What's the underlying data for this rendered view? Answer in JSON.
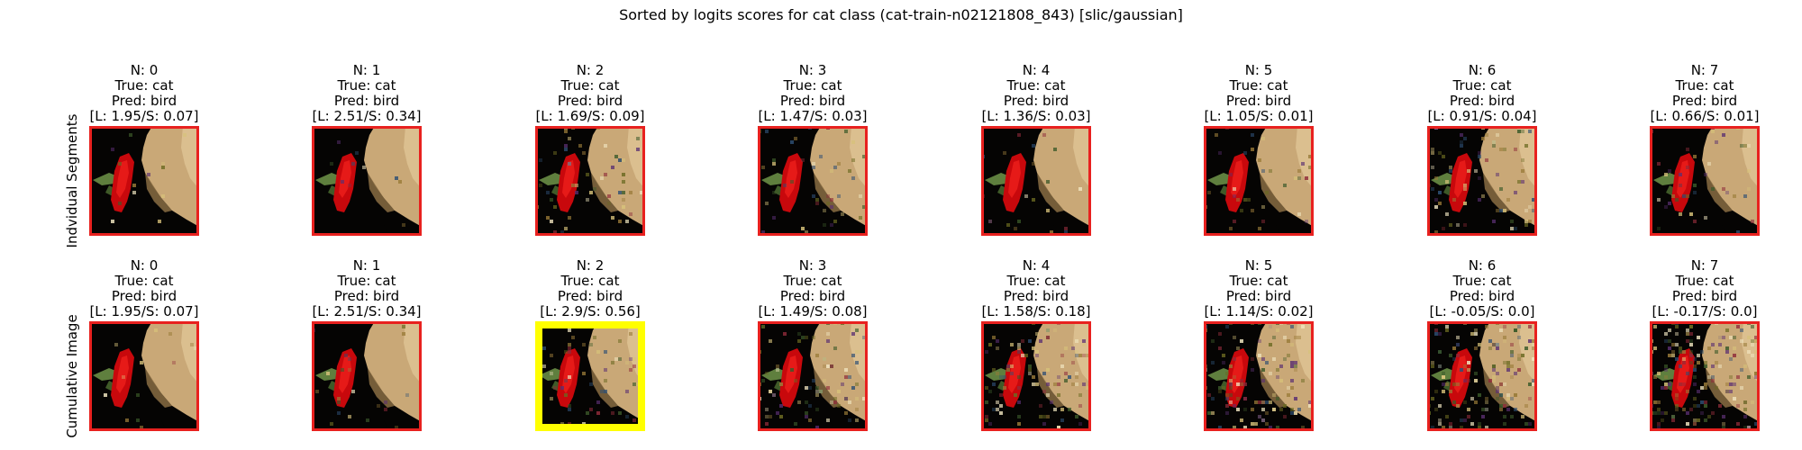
{
  "chart_data": {
    "type": "image-grid",
    "title": "Sorted by logits scores for cat class (cat-train-n02121808_843) [slic/gaussian]",
    "rows": [
      {
        "label": "Indvidual Segments",
        "panels": [
          {
            "n": "N: 0",
            "true": "True: cat",
            "pred": "Pred: bird",
            "scores": "[L: 1.95/S: 0.07]",
            "highlight": false,
            "noise": 0.05
          },
          {
            "n": "N: 1",
            "true": "True: cat",
            "pred": "Pred: bird",
            "scores": "[L: 2.51/S: 0.34]",
            "highlight": false,
            "noise": 0.04
          },
          {
            "n": "N: 2",
            "true": "True: cat",
            "pred": "Pred: bird",
            "scores": "[L: 1.69/S: 0.09]",
            "highlight": false,
            "noise": 0.22
          },
          {
            "n": "N: 3",
            "true": "True: cat",
            "pred": "Pred: bird",
            "scores": "[L: 1.47/S: 0.03]",
            "highlight": false,
            "noise": 0.18
          },
          {
            "n": "N: 4",
            "true": "True: cat",
            "pred": "Pred: bird",
            "scores": "[L: 1.36/S: 0.03]",
            "highlight": false,
            "noise": 0.08
          },
          {
            "n": "N: 5",
            "true": "True: cat",
            "pred": "Pred: bird",
            "scores": "[L: 1.05/S: 0.01]",
            "highlight": false,
            "noise": 0.14
          },
          {
            "n": "N: 6",
            "true": "True: cat",
            "pred": "Pred: bird",
            "scores": "[L: 0.91/S: 0.04]",
            "highlight": false,
            "noise": 0.3
          },
          {
            "n": "N: 7",
            "true": "True: cat",
            "pred": "Pred: bird",
            "scores": "[L: 0.66/S: 0.01]",
            "highlight": false,
            "noise": 0.16
          }
        ]
      },
      {
        "label": "Cumulative Image",
        "panels": [
          {
            "n": "N: 0",
            "true": "True: cat",
            "pred": "Pred: bird",
            "scores": "[L: 1.95/S: 0.07]",
            "highlight": false,
            "noise": 0.05
          },
          {
            "n": "N: 1",
            "true": "True: cat",
            "pred": "Pred: bird",
            "scores": "[L: 2.51/S: 0.34]",
            "highlight": false,
            "noise": 0.08
          },
          {
            "n": "N: 2",
            "true": "True: cat",
            "pred": "Pred: bird",
            "scores": "[L: 2.9/S: 0.56]",
            "highlight": true,
            "noise": 0.25
          },
          {
            "n": "N: 3",
            "true": "True: cat",
            "pred": "Pred: bird",
            "scores": "[L: 1.49/S: 0.08]",
            "highlight": false,
            "noise": 0.35
          },
          {
            "n": "N: 4",
            "true": "True: cat",
            "pred": "Pred: bird",
            "scores": "[L: 1.58/S: 0.18]",
            "highlight": false,
            "noise": 0.42
          },
          {
            "n": "N: 5",
            "true": "True: cat",
            "pred": "Pred: bird",
            "scores": "[L: 1.14/S: 0.02]",
            "highlight": false,
            "noise": 0.5
          },
          {
            "n": "N: 6",
            "true": "True: cat",
            "pred": "Pred: bird",
            "scores": "[L: -0.05/S: 0.0]",
            "highlight": false,
            "noise": 0.6
          },
          {
            "n": "N: 7",
            "true": "True: cat",
            "pred": "Pred: bird",
            "scores": "[L: -0.17/S: 0.0]",
            "highlight": false,
            "noise": 0.68
          }
        ]
      }
    ]
  },
  "colors": {
    "frame": "#e8211f",
    "highlight_frame": "#ffff00",
    "background": "#050403",
    "cat_fur": "#c9a877",
    "flower": "#c8080c",
    "leaf": "#5f7f3e"
  }
}
